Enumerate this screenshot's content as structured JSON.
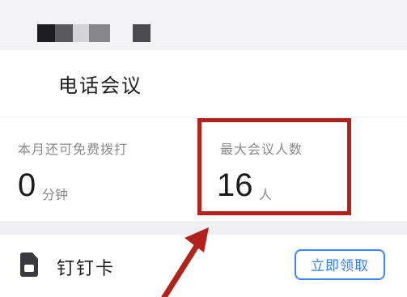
{
  "header": {
    "title": "电话会议"
  },
  "stats": {
    "free_minutes": {
      "label": "本月还可免费拨打",
      "value": "0",
      "unit": "分钟"
    },
    "max_participants": {
      "label": "最大会议人数",
      "value": "16",
      "unit": "人"
    }
  },
  "sim_row": {
    "icon": "sim-card-icon",
    "label": "钉钉卡",
    "button_label": "立即领取"
  },
  "colors": {
    "highlight": "#b0221b",
    "accent": "#3e86f5",
    "text_primary": "#1e1e1e",
    "text_secondary": "#8a8a8e",
    "background": "#f0f0f2"
  }
}
